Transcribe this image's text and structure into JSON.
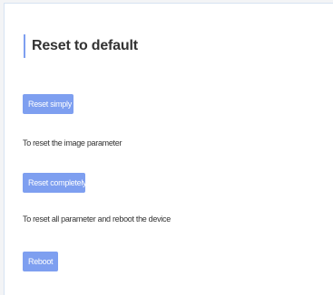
{
  "page": {
    "title": "Reset to default"
  },
  "actions": [
    {
      "button_label": "Reset simply",
      "description": "To reset the image parameter"
    },
    {
      "button_label": "Reset completely",
      "description": "To reset all parameter and reboot the device"
    },
    {
      "button_label": "Reboot"
    }
  ],
  "colors": {
    "accent": "#7e9ff0",
    "text": "#333333",
    "background": "#ffffff"
  }
}
